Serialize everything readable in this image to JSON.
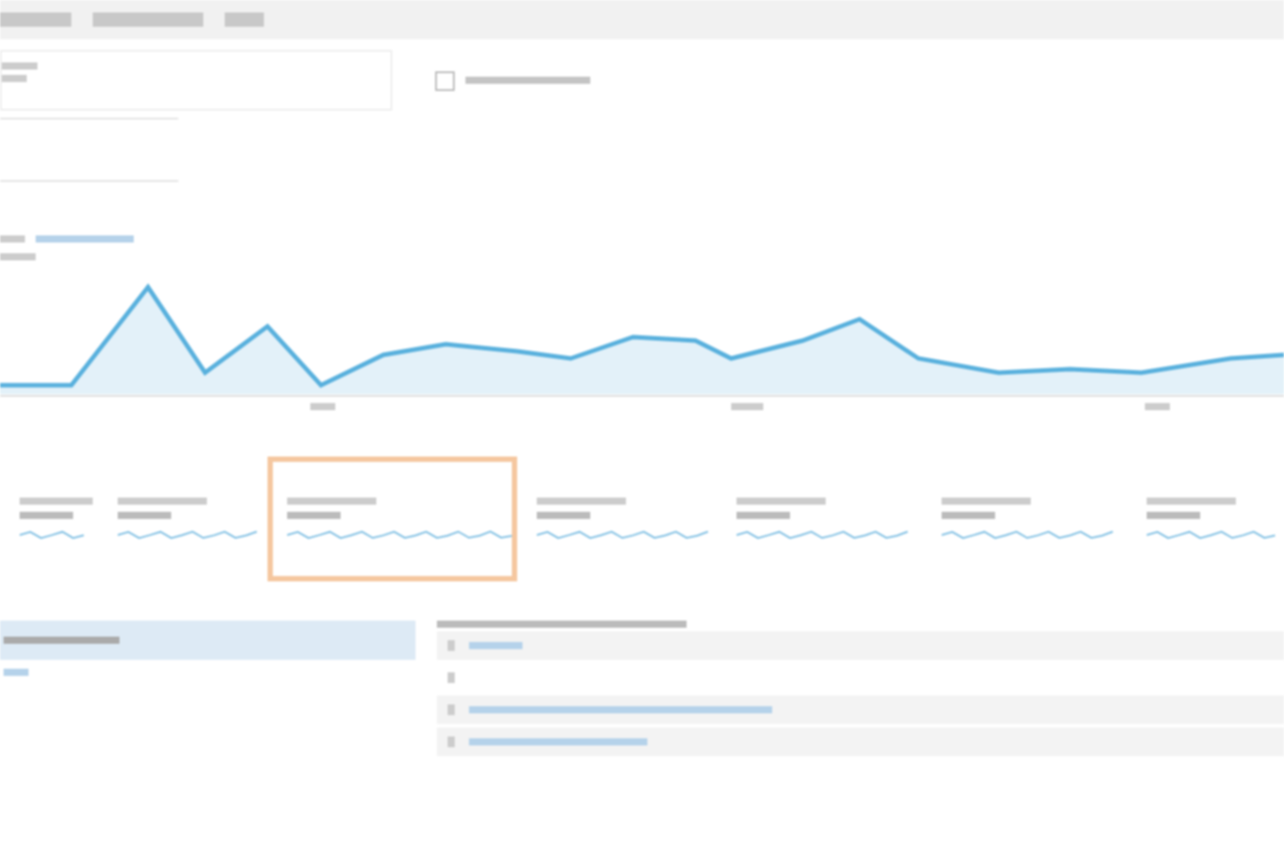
{
  "checkbox": {
    "checked": false
  },
  "metric_cards": [
    {
      "selected": false
    },
    {
      "selected": false
    },
    {
      "selected": true
    },
    {
      "selected": false
    },
    {
      "selected": false
    },
    {
      "selected": false
    },
    {
      "selected": false
    }
  ],
  "left_list": [
    {
      "selected": true
    },
    {
      "selected": false
    }
  ],
  "table_rows": [
    {
      "kind": "link"
    },
    {
      "kind": "blank"
    },
    {
      "kind": "link"
    },
    {
      "kind": "link"
    }
  ]
}
